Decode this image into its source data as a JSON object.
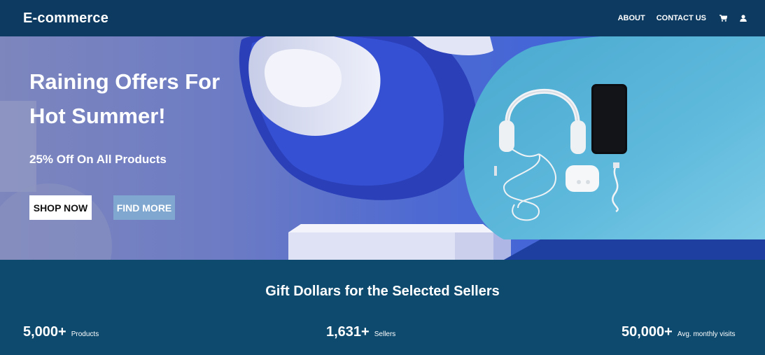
{
  "navbar": {
    "brand": "E-commerce",
    "links": [
      "ABOUT",
      "CONTACT US"
    ],
    "icons": [
      "cart-icon",
      "user-icon"
    ]
  },
  "hero": {
    "title_line1": "Raining Offers For",
    "title_line2": "Hot Summer!",
    "subtitle": "25% Off On All Products",
    "primary_button": "SHOP NOW",
    "secondary_button": "FIND MORE"
  },
  "stats": {
    "title": "Gift Dollars for the Selected Sellers",
    "items": [
      {
        "value": "5,000+",
        "label": "Products"
      },
      {
        "value": "1,631+",
        "label": "Sellers"
      },
      {
        "value": "50,000+",
        "label": "Avg. monthly visits"
      }
    ]
  },
  "colors": {
    "navbar_bg": "#0c3a60",
    "stats_bg": "#0d4a6e",
    "find_more_bg": "#7fa7cf",
    "text": "#ffffff"
  }
}
